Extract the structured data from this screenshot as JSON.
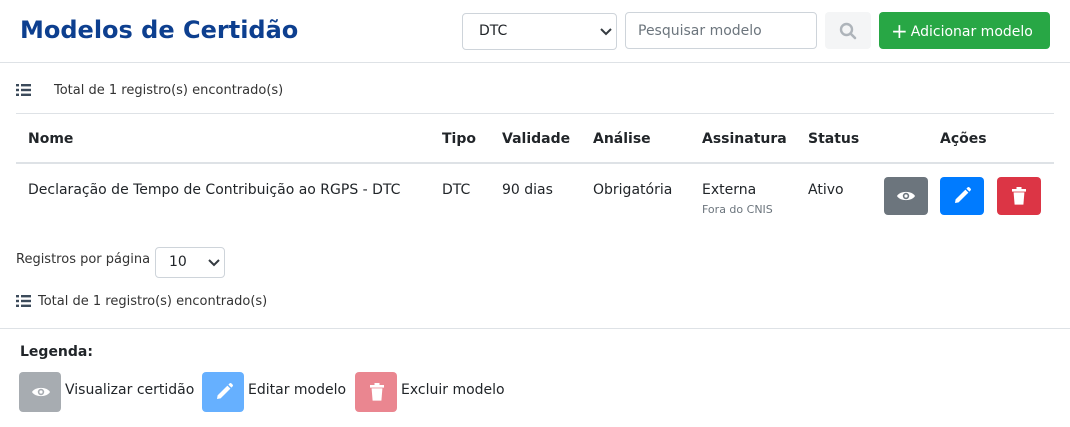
{
  "header": {
    "title": "Modelos de Certidão",
    "filter_value": "DTC",
    "search_placeholder": "Pesquisar modelo",
    "add_label": "Adicionar modelo"
  },
  "count_text": "Total de 1 registro(s) encontrado(s)",
  "table": {
    "columns": [
      "Nome",
      "Tipo",
      "Validade",
      "Análise",
      "Assinatura",
      "Status",
      "Ações"
    ],
    "rows": [
      {
        "nome": "Declaração de Tempo de Contribuição ao RGPS - DTC",
        "tipo": "DTC",
        "validade": "90 dias",
        "analise": "Obrigatória",
        "assinatura": "Externa",
        "assinatura_sub": "Fora do CNIS",
        "status": "Ativo"
      }
    ]
  },
  "pagination": {
    "label": "Registros por página",
    "value": "10"
  },
  "legend": {
    "title": "Legenda:",
    "items": [
      {
        "label": "Visualizar certidão",
        "icon": "eye-icon"
      },
      {
        "label": "Editar modelo",
        "icon": "pencil-icon"
      },
      {
        "label": "Excluir modelo",
        "icon": "trash-icon"
      }
    ]
  },
  "colors": {
    "title": "#0d3f8f",
    "success": "#28a745",
    "view": "#6c757d",
    "edit": "#007bff",
    "delete": "#dc3545"
  }
}
